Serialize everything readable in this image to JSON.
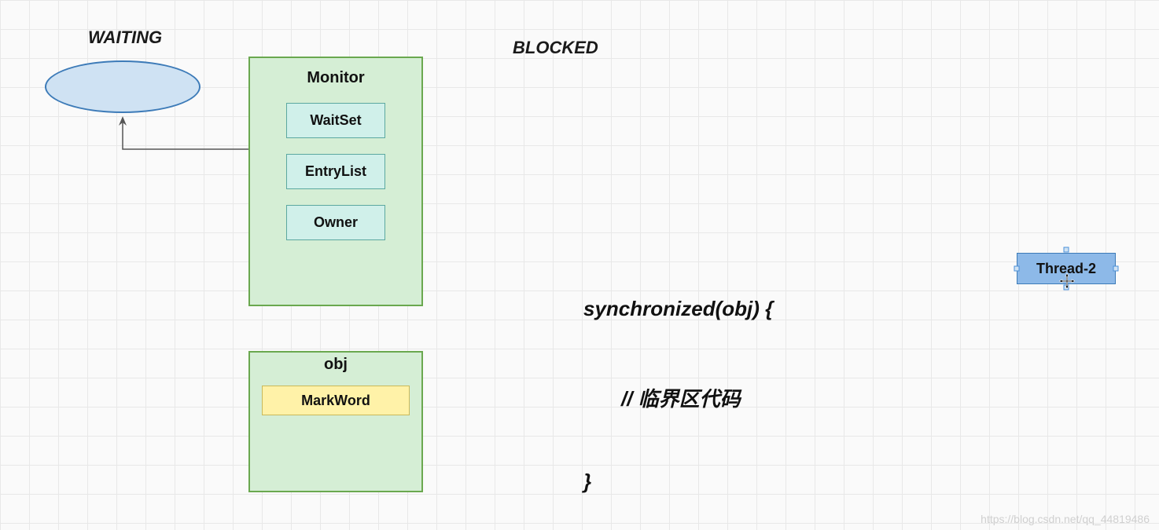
{
  "labels": {
    "waiting": "WAITING",
    "blocked": "BLOCKED"
  },
  "monitor": {
    "title": "Monitor",
    "items": [
      "WaitSet",
      "EntryList",
      "Owner"
    ]
  },
  "obj": {
    "title": "obj",
    "items": [
      "MarkWord"
    ]
  },
  "code": {
    "line1": "synchronized(obj) {",
    "line2": "// 临界区代码",
    "line3": "}"
  },
  "thread": {
    "label": "Thread-2",
    "selected": true
  },
  "watermark": "https://blog.csdn.net/qq_44819486"
}
